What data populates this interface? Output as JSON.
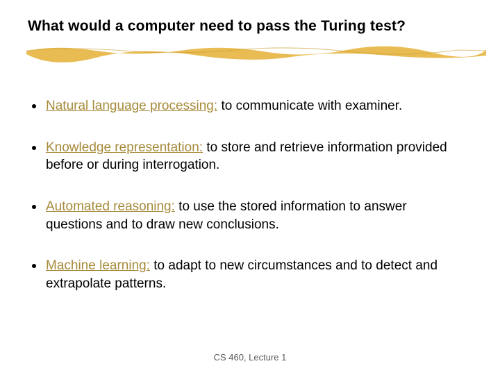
{
  "title": "What would a computer need to pass the Turing test?",
  "bullets": [
    {
      "term": "Natural language processing:",
      "rest": " to communicate with examiner."
    },
    {
      "term": "Knowledge representation:",
      "rest": " to store and retrieve information provided before or during interrogation."
    },
    {
      "term": "Automated reasoning:",
      "rest": " to use the stored information to answer questions and to draw new conclusions."
    },
    {
      "term": "Machine learning:",
      "rest": " to adapt to new circumstances and to detect and extrapolate patterns."
    }
  ],
  "footer": "CS 460,  Lecture 1"
}
